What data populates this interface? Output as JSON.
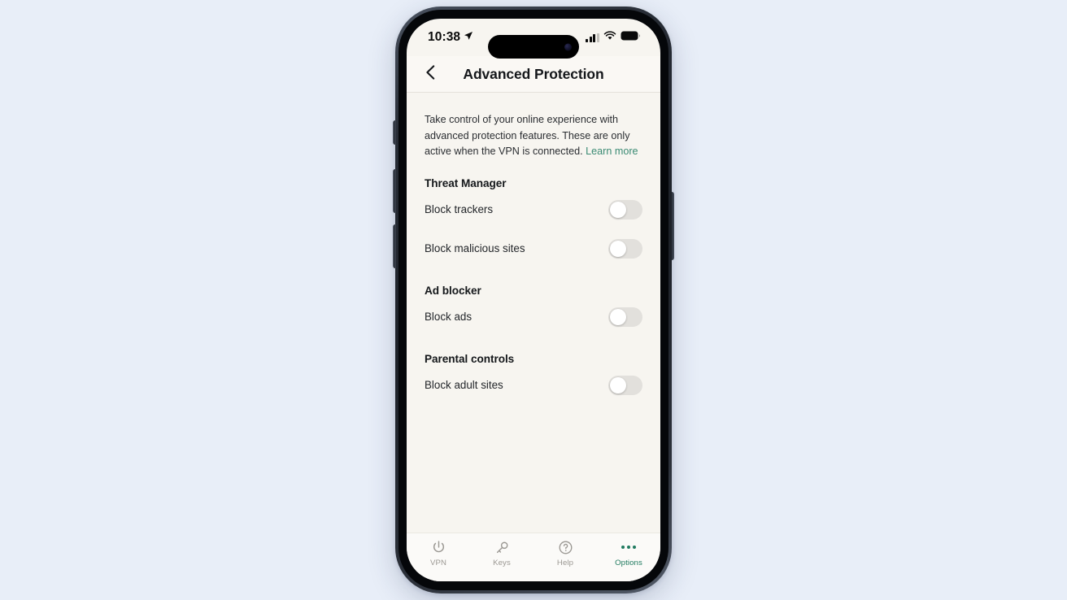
{
  "status_bar": {
    "time": "10:38",
    "location_icon": "location-arrow-icon",
    "cellular_icon": "cellular-signal-icon",
    "wifi_icon": "wifi-icon",
    "battery_icon": "battery-full-icon"
  },
  "nav": {
    "back_icon": "chevron-left-icon",
    "title": "Advanced Protection"
  },
  "intro": {
    "text": "Take control of your online experience with advanced protection features. These are only active when the VPN is connected. ",
    "link_label": "Learn more"
  },
  "sections": [
    {
      "header": "Threat Manager",
      "rows": [
        {
          "label": "Block trackers",
          "state": "off"
        },
        {
          "label": "Block malicious sites",
          "state": "off"
        }
      ]
    },
    {
      "header": "Ad blocker",
      "rows": [
        {
          "label": "Block ads",
          "state": "off"
        }
      ]
    },
    {
      "header": "Parental controls",
      "rows": [
        {
          "label": "Block adult sites",
          "state": "off"
        }
      ]
    }
  ],
  "tab_bar": {
    "items": [
      {
        "label": "VPN",
        "icon": "power-icon",
        "active": false
      },
      {
        "label": "Keys",
        "icon": "key-icon",
        "active": false
      },
      {
        "label": "Help",
        "icon": "question-circle-icon",
        "active": false
      },
      {
        "label": "Options",
        "icon": "ellipsis-icon",
        "active": true
      }
    ]
  },
  "colors": {
    "accent": "#3a8a73",
    "tab_active": "#1f7a5f",
    "app_background": "#f7f5f0",
    "page_background": "#e8eef8",
    "toggle_off_track": "#e2e0dc"
  }
}
